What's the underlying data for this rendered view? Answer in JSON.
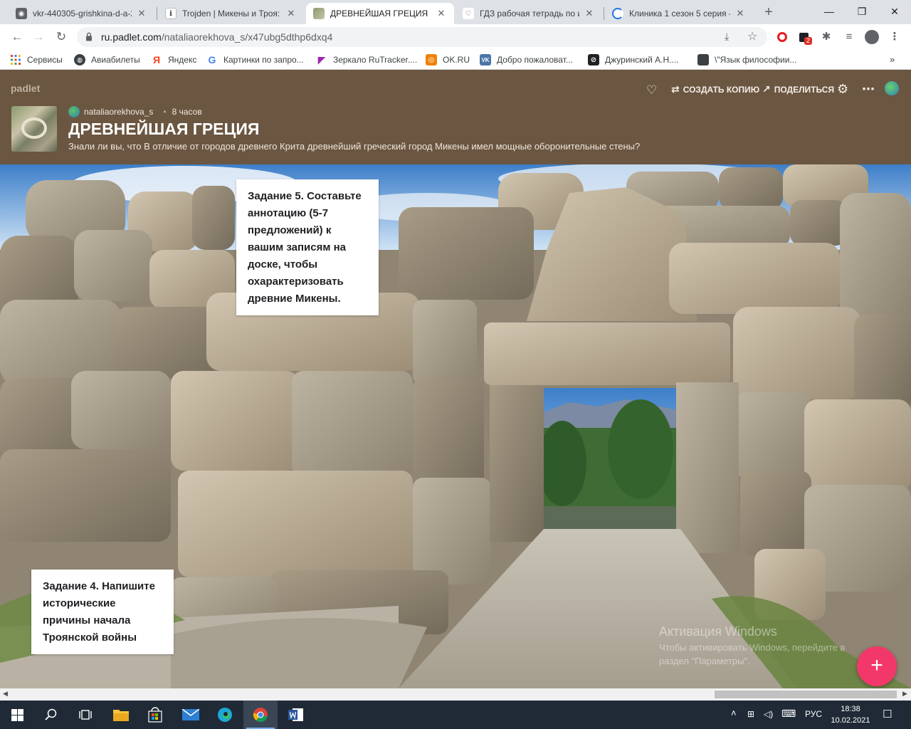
{
  "browser": {
    "tabs": [
      {
        "title": "vkr-440305-grishkina-d-a-2",
        "icon": "document-icon",
        "active": false
      },
      {
        "title": "Trojden | Микены и Троя: Б",
        "icon": "trojden-icon",
        "active": false
      },
      {
        "title": "ДРЕВНЕЙШАЯ ГРЕЦИЯ",
        "icon": "padlet-thumbnail-icon",
        "active": true
      },
      {
        "title": "ГДЗ рабочая тетрадь по и",
        "icon": "heart-icon",
        "active": false
      },
      {
        "title": "Клиника 1 сезон 5 серия –",
        "icon": "loading-icon",
        "active": false
      }
    ],
    "new_tab": "+",
    "window_controls": {
      "minimize": "—",
      "restore": "❐",
      "close": "✕"
    },
    "url_host": "ru.padlet.com",
    "url_path": "/nataliaorekhova_s/x47ubg5dthp6dxq4",
    "extension_badge": "2",
    "bookmarks": [
      {
        "label": "Сервисы",
        "icon": "apps-grid-icon"
      },
      {
        "label": "Авиабилеты",
        "icon": "globe-icon"
      },
      {
        "label": "Яндекс",
        "icon": "yandex-icon"
      },
      {
        "label": "Картинки по запро...",
        "icon": "google-icon"
      },
      {
        "label": "Зеркало RuTracker....",
        "icon": "rutracker-icon"
      },
      {
        "label": "OK.RU",
        "icon": "odnoklassniki-icon"
      },
      {
        "label": "Добро пожаловат...",
        "icon": "vk-icon"
      },
      {
        "label": "Джуринский А.Н....",
        "icon": "bookmark-icon"
      },
      {
        "label": "\\\"Язык философии...",
        "icon": "bookmark-icon"
      }
    ],
    "bookmark_letters": {
      "yandex": "Я",
      "google": "G",
      "vk": "VK"
    }
  },
  "padlet": {
    "logo": "padlet",
    "actions": {
      "remix": "СОЗДАТЬ КОПИЮ",
      "share": "ПОДЕЛИТЬСЯ"
    },
    "author": "nataliaorekhova_s",
    "time_ago": "8 часов",
    "title": "ДРЕВНЕЙШАЯ ГРЕЦИЯ",
    "description": "Знали ли вы, что В отличие от городов древнего Крита древнейший греческий город Микены имел мощные оборонительные стены?",
    "posts": [
      {
        "text": "Задание 5. Составьте аннотацию (5-7 предложений) к вашим записям на доске, чтобы охарактеризовать древние Микены."
      },
      {
        "text": "Задание 4. Напишите исторические причины начала Троянской войны"
      }
    ],
    "add_button": "+"
  },
  "watermark": {
    "line1": "Активация Windows",
    "line2": "Чтобы активировать Windows, перейдите в",
    "line3": "раздел \"Параметры\"."
  },
  "taskbar": {
    "language": "РУС",
    "time": "18:38",
    "date": "10.02.2021"
  }
}
